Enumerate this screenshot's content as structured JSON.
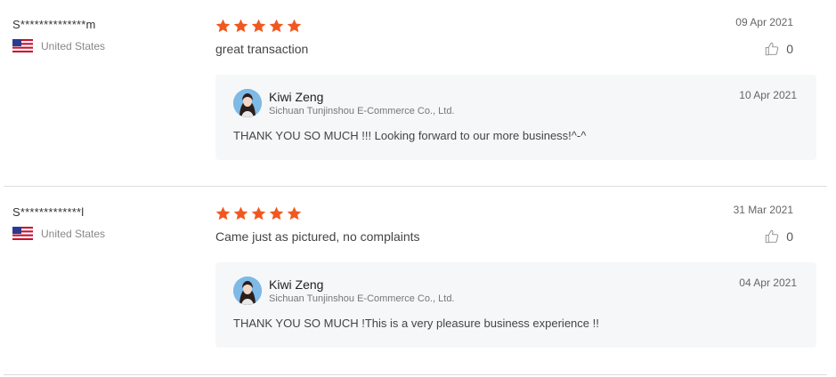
{
  "reviews": [
    {
      "reviewer": "S**************m",
      "country": "United States",
      "date": "09 Apr 2021",
      "text": "great transaction",
      "likes": "0",
      "rating": 5,
      "reply": {
        "seller_name": "Kiwi Zeng",
        "company": "Sichuan Tunjinshou E-Commerce Co., Ltd.",
        "date": "10 Apr 2021",
        "text": "THANK YOU SO MUCH !!! Looking forward to our more business!^-^"
      }
    },
    {
      "reviewer": "S*************l",
      "country": "United States",
      "date": "31 Mar 2021",
      "text": "Came just as pictured, no complaints",
      "likes": "0",
      "rating": 5,
      "reply": {
        "seller_name": "Kiwi Zeng",
        "company": "Sichuan Tunjinshou E-Commerce Co., Ltd.",
        "date": "04 Apr 2021",
        "text": "THANK YOU SO MUCH !This is a very pleasure business experience !!"
      }
    }
  ],
  "colors": {
    "star": "#f1581f",
    "reply_bg": "#f6f7f9",
    "divider": "#dedede"
  },
  "icons": {
    "flag": "us-flag-icon",
    "star": "star-icon",
    "like": "thumbs-up-icon",
    "avatar": "seller-avatar"
  }
}
